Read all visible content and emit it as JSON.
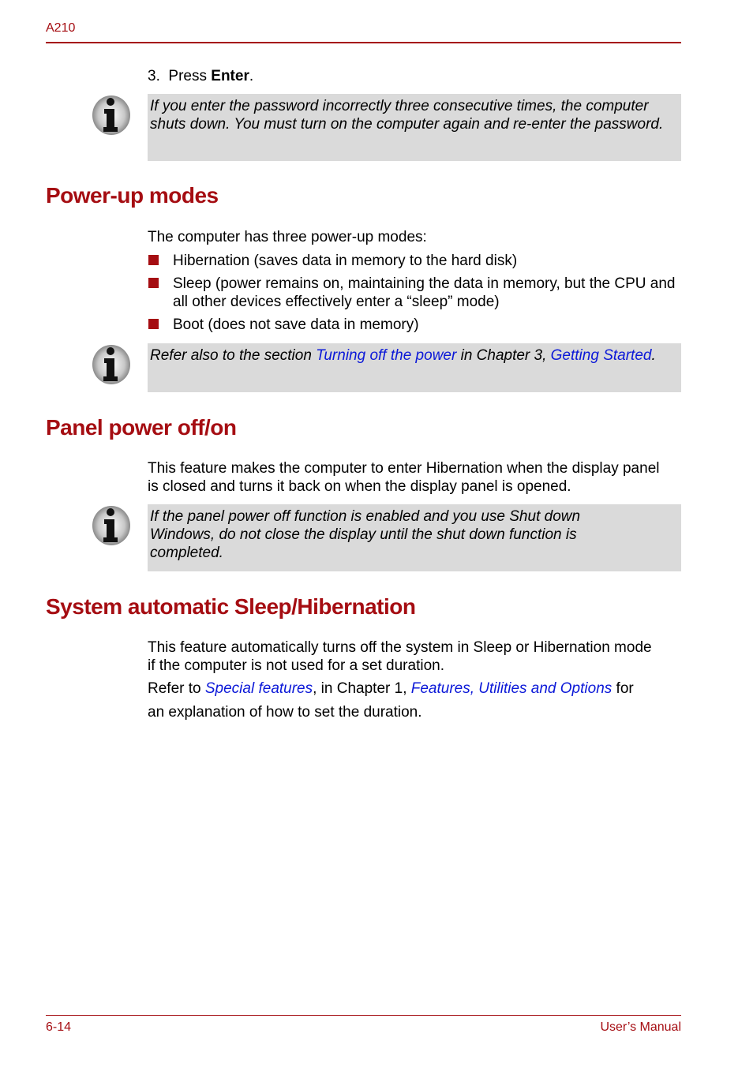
{
  "header": {
    "model": "A210"
  },
  "step": {
    "number": "3.",
    "text_before": "Press ",
    "bold": "Enter",
    "text_after": "."
  },
  "notes": [
    {
      "icon": "info-icon",
      "text": "If you enter the password incorrectly three consecutive times, the computer shuts down. You must turn on the computer again and re-enter the password."
    },
    {
      "icon": "info-icon",
      "prefix": "Refer also to the section ",
      "link1": "Turning off the power",
      "middle": " in Chapter 3, ",
      "link2": "Getting Started",
      "suffix": "."
    },
    {
      "icon": "info-icon",
      "text": "If the panel power off function is enabled and you use Shut down Windows, do not close the display until the shut down function is completed."
    }
  ],
  "sections": {
    "power_up": {
      "title": "Power-up modes",
      "intro": "The computer has three power-up modes:",
      "items": [
        "Hibernation (saves data in memory to the hard disk)",
        "Sleep (power remains on, maintaining the data in memory, but the CPU and all other devices effectively enter a “sleep” mode)",
        "Boot (does not save data in memory)"
      ]
    },
    "panel_power": {
      "title": "Panel power off/on",
      "body": "This feature makes the computer to enter Hibernation when the display panel is closed and turns it back on when the display panel is opened."
    },
    "auto_sleep": {
      "title": "System automatic Sleep/Hibernation",
      "body": "This feature automatically turns off the system in Sleep or Hibernation mode if the computer is not used for a set duration.",
      "refer_prefix": "Refer to ",
      "refer_link1": "Special features",
      "refer_middle": ", in Chapter 1, ",
      "refer_link2": "Features, Utilities and Options",
      "refer_suffix": " for",
      "refer_line2": "an explanation of how to set the duration."
    }
  },
  "footer": {
    "page": "6-14",
    "title": "User’s Manual"
  },
  "colors": {
    "accent": "#a50d12",
    "link": "#0b18d8",
    "note_bg": "#dadada"
  }
}
